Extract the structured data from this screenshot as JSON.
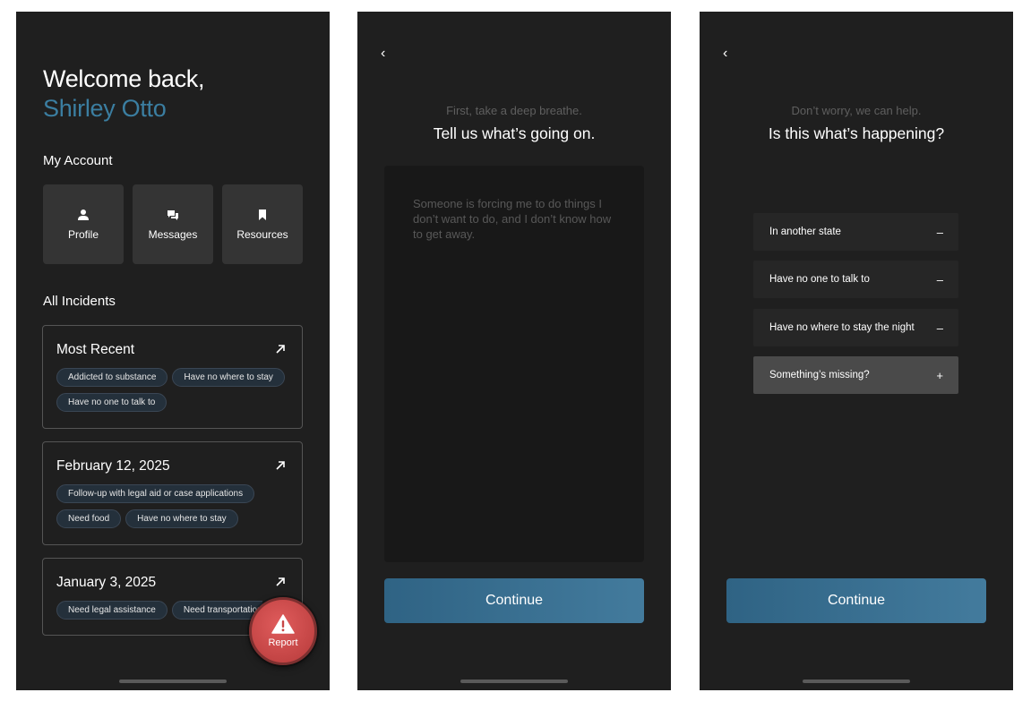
{
  "screen1": {
    "welcome": "Welcome back,",
    "user_name": "Shirley Otto",
    "my_account": "My Account",
    "account_items": [
      {
        "label": "Profile",
        "icon": "person-icon"
      },
      {
        "label": "Messages",
        "icon": "chat-bubbles-icon"
      },
      {
        "label": "Resources",
        "icon": "bookmark-icon"
      }
    ],
    "all_incidents": "All Incidents",
    "incidents": [
      {
        "title": "Most Recent",
        "tags": [
          "Addicted to substance",
          "Have no where to stay",
          "Have no one to talk to"
        ]
      },
      {
        "title": "February 12, 2025",
        "tags": [
          "Follow-up with legal aid or case applications",
          "Need food",
          "Have no where to stay"
        ]
      },
      {
        "title": "January 3, 2025",
        "tags": [
          "Need legal assistance",
          "Need transportation"
        ]
      }
    ],
    "report_label": "Report"
  },
  "screen2": {
    "back": "‹",
    "subtitle": "First, take a deep breathe.",
    "heading": "Tell us what’s going on.",
    "textarea_placeholder": "Someone is forcing me to do things I don’t want to do, and I don’t know how to get away.",
    "continue_label": "Continue"
  },
  "screen3": {
    "back": "‹",
    "subtitle": "Don’t worry, we can help.",
    "heading": "Is this what’s happening?",
    "options": [
      {
        "label": "In another state",
        "symbol": "–"
      },
      {
        "label": "Have no one to talk to",
        "symbol": "–"
      },
      {
        "label": "Have no where to stay the night",
        "symbol": "–"
      },
      {
        "label": "Something’s missing?",
        "symbol": "+"
      }
    ],
    "continue_label": "Continue"
  },
  "colors": {
    "background": "#1f1f1f",
    "accent_name": "#3b7ea1",
    "button": "#3a7193",
    "report": "#d04848"
  }
}
